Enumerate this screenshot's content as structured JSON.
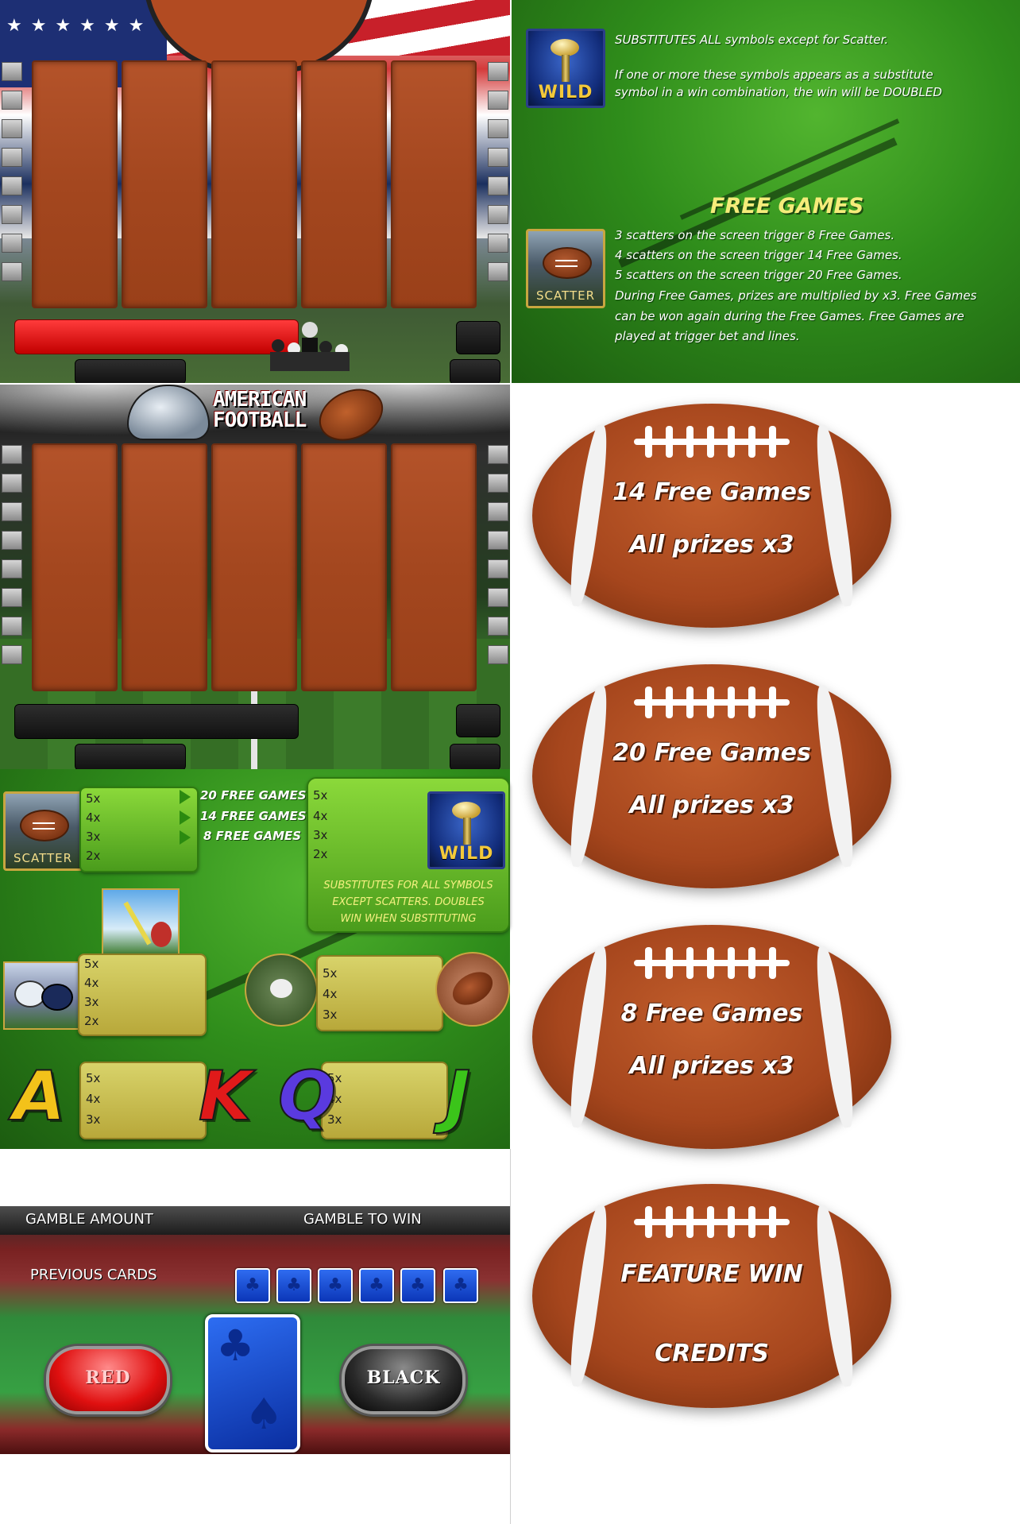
{
  "panel1": {
    "reels": 5
  },
  "panel2": {
    "wild_label": "WILD",
    "wild_text_1": "SUBSTITUTES ALL symbols except for Scatter.",
    "wild_text_2a": "If one or more these symbols appears as a substitute",
    "wild_text_2b": "symbol in a win combination, the win will be DOUBLED",
    "free_games_title": "FREE GAMES",
    "scatter_label": "SCATTER",
    "free_lines": [
      "3 scatters on the screen trigger 8 Free Games.",
      "4 scatters on the screen trigger 14 Free Games.",
      "5 scatters on the screen trigger 20 Free Games.",
      "During Free Games, prizes are multiplied by x3. Free Games",
      "can be won again during the Free Games. Free Games are",
      "played at trigger bet and lines."
    ]
  },
  "panel3": {
    "logo_line1": "AMERICAN",
    "logo_line2": "FOOTBALL"
  },
  "paytable": {
    "scatter_label": "SCATTER",
    "scatter_rows": [
      "5x",
      "4x",
      "3x",
      "2x"
    ],
    "scatter_prizes": [
      "20 FREE GAMES",
      "14 FREE GAMES",
      "8 FREE GAMES"
    ],
    "wild_label": "WILD",
    "wild_rows": [
      "5x",
      "4x",
      "3x",
      "2x"
    ],
    "wild_note_1": "SUBSTITUTES FOR ALL SYMBOLS",
    "wild_note_2": "EXCEPT SCATTERS. DOUBLES",
    "wild_note_3": "WIN WHEN SUBSTITUTING",
    "helmet_rows": [
      "5x",
      "4x",
      "3x",
      "2x"
    ],
    "tackle_rows": [
      "5x",
      "4x",
      "3x"
    ],
    "letters_left_rows": [
      "5x",
      "4x",
      "3x"
    ],
    "letters_right_rows": [
      "5x",
      "4x",
      "3x"
    ],
    "letters": [
      "A",
      "K",
      "Q",
      "J"
    ],
    "letter_colors": [
      "#f3c21a",
      "#e01a1a",
      "#5a3adf",
      "#3bc41a"
    ]
  },
  "gamble": {
    "amount_label": "GAMBLE AMOUNT",
    "to_win_label": "GAMBLE TO WIN",
    "previous_label": "PREVIOUS CARDS",
    "red_label": "RED",
    "black_label": "BLACK"
  },
  "balls": [
    {
      "line1": "14 Free Games",
      "line2": "All prizes  x3"
    },
    {
      "line1": "20 Free Games",
      "line2": "All prizes  x3"
    },
    {
      "line1": "8 Free Games",
      "line2": "All prizes  x3"
    },
    {
      "line1": "FEATURE WIN",
      "line2": "CREDITS"
    }
  ]
}
